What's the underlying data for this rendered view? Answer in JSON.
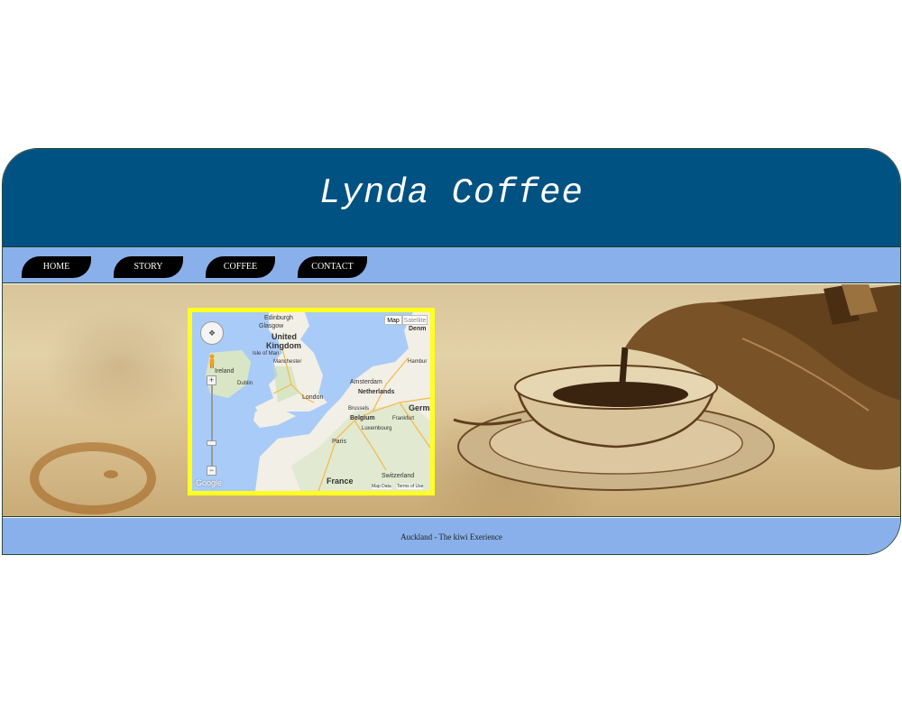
{
  "site": {
    "title": "Lynda Coffee",
    "colors": {
      "header": "#005282",
      "nav": "#89b0ea",
      "nav_button": "#000000",
      "map_border": "#ffff22"
    }
  },
  "nav": {
    "items": [
      {
        "label": "HOME"
      },
      {
        "label": "STORY"
      },
      {
        "label": "COFFEE"
      },
      {
        "label": "CONTACT"
      }
    ]
  },
  "map": {
    "type_buttons": {
      "map": "Map",
      "satellite": "Satellite"
    },
    "places": {
      "edinburgh": "Edinburgh",
      "glasgow": "Glasgow",
      "uk_line1": "United",
      "uk_line2": "Kingdom",
      "isle_of_man": "Isle of Man",
      "ireland": "Ireland",
      "dublin": "Dublin",
      "manchester": "Manchester",
      "london": "London",
      "amsterdam": "Amsterdam",
      "netherlands": "Netherlands",
      "hamburg": "Hambur",
      "denmark": "Denm",
      "brussels": "Brussels",
      "belgium": "Belgium",
      "germany": "Germa",
      "frankfurt": "Frankfurt",
      "luxembourg": "Luxembourg",
      "paris": "Paris",
      "france": "France",
      "switzerland": "Switzerland"
    },
    "footer": {
      "map_data": "Map Data",
      "terms": "Terms of Use"
    },
    "logo": "Google",
    "icons": {
      "pan": "pan-control-icon",
      "pegman": "pegman-icon",
      "zoom_in": "zoom-in-icon",
      "zoom_out": "zoom-out-icon"
    }
  },
  "footer": {
    "text": "Auckland - The kiwi Exerience"
  }
}
